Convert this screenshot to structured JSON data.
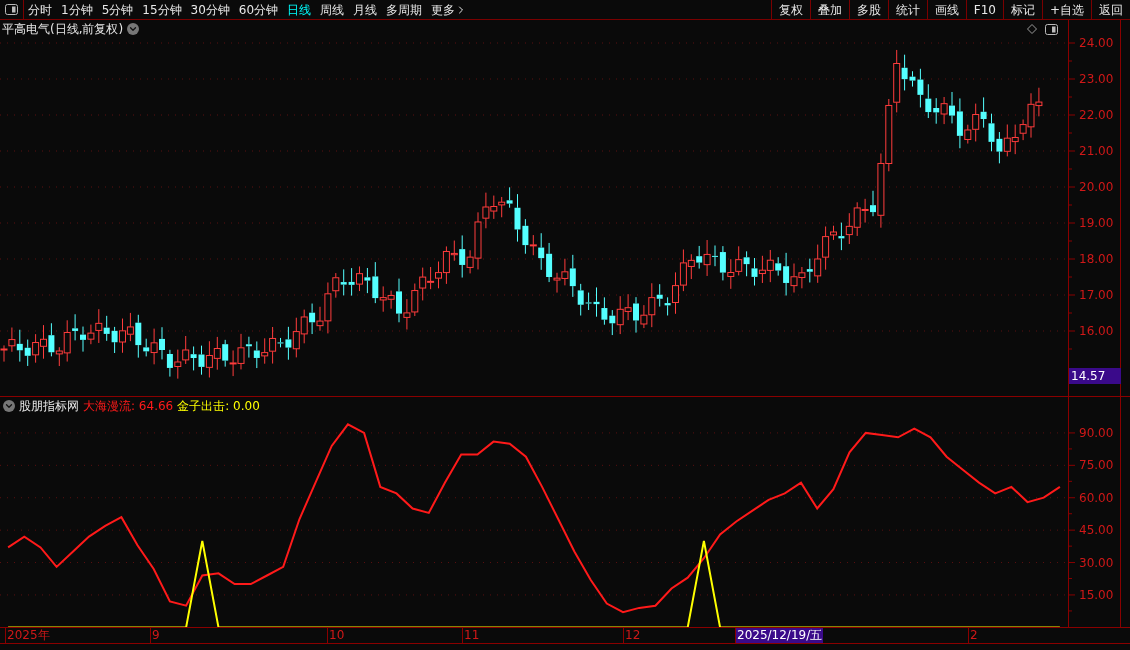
{
  "toolbar": {
    "periods": [
      {
        "label": "分时",
        "kind": "period",
        "selected": false
      },
      {
        "label": "1分钟",
        "kind": "period",
        "selected": false
      },
      {
        "label": "5分钟",
        "kind": "period",
        "selected": false
      },
      {
        "label": "15分钟",
        "kind": "period",
        "selected": false
      },
      {
        "label": "30分钟",
        "kind": "period",
        "selected": false
      },
      {
        "label": "60分钟",
        "kind": "period",
        "selected": false
      },
      {
        "label": "日线",
        "kind": "period",
        "selected": true
      },
      {
        "label": "周线",
        "kind": "period",
        "selected": false
      },
      {
        "label": "月线",
        "kind": "period",
        "selected": false
      },
      {
        "label": "多周期",
        "kind": "period",
        "selected": false
      },
      {
        "label": "更多",
        "kind": "menu",
        "selected": false
      }
    ],
    "buttons": [
      "复权",
      "叠加",
      "多股",
      "统计",
      "画线",
      "F10",
      "标记",
      "+自选",
      "返回"
    ]
  },
  "chart": {
    "title": "平高电气(日线,前复权)",
    "price_ticks": [
      "24.00",
      "23.00",
      "22.00",
      "21.00",
      "20.00",
      "19.00",
      "18.00",
      "17.00",
      "16.00"
    ],
    "last_price": "14.57"
  },
  "indicator": {
    "name": "股朋指标网",
    "readings": [
      ": 64.66",
      ": 0.00"
    ],
    "chart_data": {
      "type": "line",
      "grid": true,
      "ylim": [
        -0.3,
        98.3
      ],
      "yticks": [
        {
          "value": 90,
          "label": "90.00"
        },
        {
          "value": 75,
          "label": "75.00"
        },
        {
          "value": 60,
          "label": "60.00"
        },
        {
          "value": 45,
          "label": "45.00"
        },
        {
          "value": 30,
          "label": "30.00"
        },
        {
          "value": 15,
          "label": "15.00"
        }
      ],
      "series": [
        {
          "name": "大海漫流",
          "color": "#ff1a1a",
          "values": [
            37,
            42,
            37,
            28,
            35,
            42,
            47,
            51,
            38,
            27,
            12,
            10,
            24,
            25,
            20,
            20,
            24,
            28,
            50,
            67,
            84,
            94,
            90,
            65,
            62,
            55,
            53,
            67,
            80,
            80,
            86,
            85,
            79,
            65,
            50,
            35,
            22,
            11,
            7,
            9,
            10,
            18,
            23,
            32,
            43,
            49,
            54,
            59,
            62,
            67,
            55,
            64,
            81,
            90,
            89,
            88,
            92,
            88,
            79,
            73,
            67,
            62,
            65,
            58,
            60,
            65
          ]
        },
        {
          "name": "金子出击",
          "color": "#ffff00",
          "values": [
            0,
            0,
            0,
            0,
            0,
            0,
            0,
            0,
            0,
            0,
            0,
            0,
            40,
            0,
            0,
            0,
            0,
            0,
            0,
            0,
            0,
            0,
            0,
            0,
            0,
            0,
            0,
            0,
            0,
            0,
            0,
            0,
            0,
            0,
            0,
            0,
            0,
            0,
            0,
            0,
            0,
            0,
            0,
            40,
            0,
            0,
            0,
            0,
            0,
            0,
            0,
            0,
            0,
            0,
            0,
            0,
            0,
            0,
            0,
            0,
            0,
            0,
            0,
            0,
            0,
            0
          ]
        }
      ]
    }
  },
  "date_axis": [
    {
      "label": "2025年",
      "selected": false
    },
    {
      "label": "9",
      "selected": false
    },
    {
      "label": "10",
      "selected": false
    },
    {
      "label": "11",
      "selected": false
    },
    {
      "label": "12",
      "selected": false
    },
    {
      "label": "2025/12/19/五",
      "selected": true
    },
    {
      "label": "2",
      "selected": false
    }
  ]
}
